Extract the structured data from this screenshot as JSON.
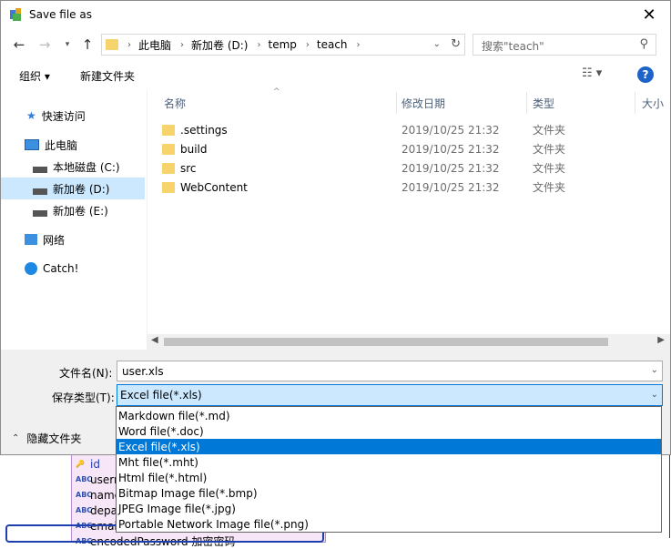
{
  "window": {
    "title": "Save file as",
    "close_glyph": "✕"
  },
  "nav": {
    "back": "←",
    "forward": "→",
    "up": "↑",
    "breadcrumbs": [
      "此电脑",
      "新加卷 (D:)",
      "temp",
      "teach"
    ],
    "search_placeholder": "搜索\"teach\""
  },
  "toolbar": {
    "organize": "组织 ▾",
    "new_folder": "新建文件夹",
    "help": "?"
  },
  "sidebar": {
    "items": [
      {
        "label": "快速访问",
        "icon": "star-icon"
      },
      {
        "label": "此电脑",
        "icon": "computer-icon"
      },
      {
        "label": "本地磁盘 (C:)",
        "icon": "drive-icon"
      },
      {
        "label": "新加卷 (D:)",
        "icon": "drive-icon",
        "selected": true
      },
      {
        "label": "新加卷 (E:)",
        "icon": "drive-icon"
      },
      {
        "label": "网络",
        "icon": "network-icon"
      },
      {
        "label": "Catch!",
        "icon": "catch-icon"
      }
    ]
  },
  "columns": {
    "name": "名称",
    "date": "修改日期",
    "type": "类型",
    "size": "大小"
  },
  "files": [
    {
      "name": ".settings",
      "date": "2019/10/25 21:32",
      "type": "文件夹"
    },
    {
      "name": "build",
      "date": "2019/10/25 21:32",
      "type": "文件夹"
    },
    {
      "name": "src",
      "date": "2019/10/25 21:32",
      "type": "文件夹"
    },
    {
      "name": "WebContent",
      "date": "2019/10/25 21:32",
      "type": "文件夹"
    }
  ],
  "form": {
    "filename_label": "文件名(N):",
    "filename_value": "user.xls",
    "filetype_label": "保存类型(T):",
    "filetype_value": "Excel file(*.xls)",
    "hide_folders": "隐藏文件夹"
  },
  "filetype_options": [
    "Markdown file(*.md)",
    "Word file(*.doc)",
    "Excel file(*.xls)",
    "Mht file(*.mht)",
    "Html file(*.html)",
    "Bitmap Image file(*.bmp)",
    "JPEG Image file(*.jpg)",
    "Portable Network Image file(*.png)"
  ],
  "background_fields": [
    "id",
    "usern",
    "name",
    "depa",
    "email",
    "encodedPassword 加密密码"
  ],
  "colors": {
    "accent": "#0078d7",
    "selection": "#cce8ff",
    "folder": "#f6d36b"
  }
}
